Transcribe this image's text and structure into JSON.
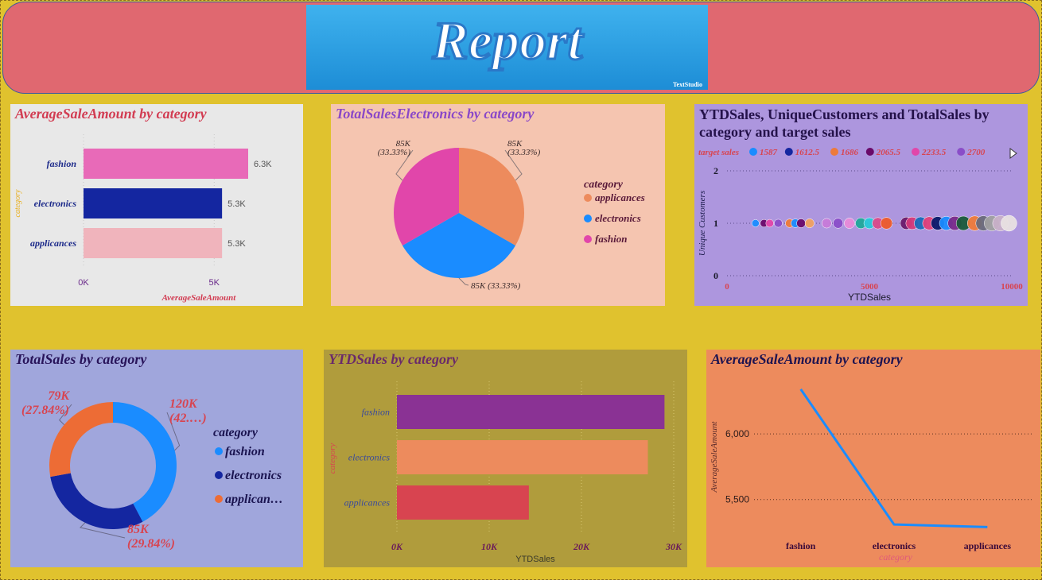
{
  "banner": {
    "logo_text": "Report",
    "logo_credit": "TextStudio"
  },
  "chart_data": [
    {
      "id": "avg_bar",
      "type": "bar",
      "orientation": "horizontal",
      "title": "AverageSaleAmount by category",
      "xlabel": "AverageSaleAmount",
      "ylabel": "category",
      "categories": [
        "fashion",
        "electronics",
        "applicances"
      ],
      "values": [
        6300,
        5300,
        5300
      ],
      "data_labels": [
        "6.3K",
        "5.3K",
        "5.3K"
      ],
      "colors": [
        "#e86ab8",
        "#1426a0",
        "#f0b4bc"
      ],
      "xticks": [
        "0K",
        "5K"
      ],
      "xlim": [
        0,
        7000
      ],
      "background": "#e8e8e8"
    },
    {
      "id": "elec_pie",
      "type": "pie",
      "title": "TotalSalesElectronics by category",
      "legend_title": "category",
      "categories": [
        "applicances",
        "electronics",
        "fashion"
      ],
      "values": [
        85000,
        85000,
        85000
      ],
      "data_labels": [
        "85K (33.33%)",
        "85K (33.33%)",
        "85K (33.33%)"
      ],
      "colors": [
        "#ed8b5d",
        "#1a8cff",
        "#e146aa"
      ],
      "legend_position": "right",
      "background": "#f5c5b0"
    },
    {
      "id": "ytd_scatter",
      "type": "scatter",
      "title": "YTDSales, UniqueCustomers and TotalSales by category and target sales",
      "legend_title": "target sales",
      "legend": [
        {
          "label": "1587",
          "color": "#1a8cff"
        },
        {
          "label": "1612.5",
          "color": "#1426a0"
        },
        {
          "label": "1686",
          "color": "#ed7a3a"
        },
        {
          "label": "2065.5",
          "color": "#6a0a6a"
        },
        {
          "label": "2233.5",
          "color": "#e146aa"
        },
        {
          "label": "2700",
          "color": "#8a4dc8"
        }
      ],
      "xlabel": "YTDSales",
      "ylabel": "Unique Customers",
      "xticks": [
        "0",
        "5000",
        "10000"
      ],
      "yticks": [
        "0",
        "1",
        "2"
      ],
      "xlim": [
        0,
        10000
      ],
      "ylim": [
        0,
        2
      ],
      "points": [
        {
          "x": 1000,
          "y": 1,
          "c": "#1a8cff"
        },
        {
          "x": 1300,
          "y": 1,
          "c": "#6a0a6a"
        },
        {
          "x": 1500,
          "y": 1,
          "c": "#e146aa"
        },
        {
          "x": 1800,
          "y": 1,
          "c": "#8a4dc8"
        },
        {
          "x": 2200,
          "y": 1,
          "c": "#ed7a3a"
        },
        {
          "x": 2400,
          "y": 1,
          "c": "#1a8cff"
        },
        {
          "x": 2600,
          "y": 1,
          "c": "#6a0a6a"
        },
        {
          "x": 2900,
          "y": 1,
          "c": "#f0a060"
        },
        {
          "x": 3500,
          "y": 1,
          "c": "#c77ad8"
        },
        {
          "x": 3900,
          "y": 1,
          "c": "#8a4dc8"
        },
        {
          "x": 4300,
          "y": 1,
          "c": "#e88ad8"
        },
        {
          "x": 4700,
          "y": 1,
          "c": "#1fa89a"
        },
        {
          "x": 5000,
          "y": 1,
          "c": "#28c8d8"
        },
        {
          "x": 5300,
          "y": 1,
          "c": "#d84a8a"
        },
        {
          "x": 5600,
          "y": 1,
          "c": "#ed5a2a"
        },
        {
          "x": 6300,
          "y": 1,
          "c": "#6a1a6a"
        },
        {
          "x": 6500,
          "y": 1,
          "c": "#d43a7a"
        },
        {
          "x": 6800,
          "y": 1,
          "c": "#1a6ab8"
        },
        {
          "x": 7100,
          "y": 1,
          "c": "#e0407a"
        },
        {
          "x": 7400,
          "y": 1,
          "c": "#0a1a6a"
        },
        {
          "x": 7700,
          "y": 1,
          "c": "#1a8cff"
        },
        {
          "x": 8000,
          "y": 1,
          "c": "#7a2a8a"
        },
        {
          "x": 8300,
          "y": 1,
          "c": "#1a5a3a"
        },
        {
          "x": 8700,
          "y": 1,
          "c": "#ed7a3a"
        },
        {
          "x": 9000,
          "y": 1,
          "c": "#6a6a7a"
        },
        {
          "x": 9300,
          "y": 1,
          "c": "#a0a0a0"
        },
        {
          "x": 9600,
          "y": 1,
          "c": "#c8b0c8"
        },
        {
          "x": 9900,
          "y": 1,
          "c": "#e8e0e0"
        }
      ],
      "background": "#ad96de"
    },
    {
      "id": "total_donut",
      "type": "pie",
      "style": "donut",
      "title": "TotalSales by category",
      "legend_title": "category",
      "categories": [
        "fashion",
        "electronics",
        "applican…"
      ],
      "values": [
        120000,
        85000,
        79000
      ],
      "data_labels": [
        "120K (42.…)",
        "85K (29.84%)",
        "79K (27.84%)"
      ],
      "label_lines": [
        [
          "120K",
          "(42.…)"
        ],
        [
          "85K",
          "(29.84%)"
        ],
        [
          "79K",
          "(27.84%)"
        ]
      ],
      "colors": [
        "#1a8cff",
        "#1426a0",
        "#ed6c35"
      ],
      "legend_position": "right",
      "background": "#a0a6dc"
    },
    {
      "id": "ytd_bar",
      "type": "bar",
      "orientation": "horizontal",
      "title": "YTDSales by category",
      "xlabel": "YTDSales",
      "ylabel": "category",
      "categories": [
        "fashion",
        "electronics",
        "applicances"
      ],
      "values": [
        29000,
        27200,
        14300
      ],
      "colors": [
        "#8a3294",
        "#ed8b5d",
        "#d84450"
      ],
      "xticks": [
        "0K",
        "10K",
        "20K",
        "30K"
      ],
      "xlim": [
        0,
        30000
      ],
      "background": "#b09c3c"
    },
    {
      "id": "avg_line",
      "type": "line",
      "title": "AverageSaleAmount by category",
      "xlabel": "category",
      "ylabel": "AverageSaleAmount",
      "categories": [
        "fashion",
        "electronics",
        "applicances"
      ],
      "values": [
        6340,
        5310,
        5290
      ],
      "yticks": [
        "6,000",
        "5,500"
      ],
      "ytick_values": [
        6000,
        5500
      ],
      "ylim": [
        5250,
        6400
      ],
      "color": "#1a8cff",
      "background": "#ed8b5d"
    }
  ]
}
